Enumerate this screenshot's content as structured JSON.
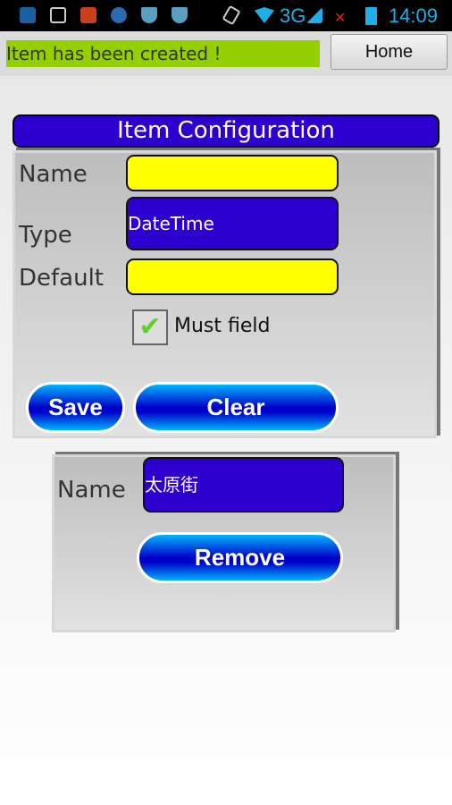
{
  "status_bar": {
    "time": "14:09",
    "network": "3G",
    "icons": [
      "sim-toolkit-icon",
      "gallery-icon",
      "s-app-icon",
      "globe-icon",
      "shield-icon",
      "shield-globe-icon",
      "rotate-icon",
      "wifi-icon",
      "signal-icon",
      "no-sim-icon",
      "battery-icon"
    ]
  },
  "top": {
    "message": "Item has been created !",
    "home_label": "Home"
  },
  "config": {
    "title": "Item Configuration",
    "name_label": "Name",
    "name_value": "",
    "type_label": "Type",
    "type_value": "DateTime",
    "default_label": "Default",
    "default_value": "",
    "must_label": "Must field",
    "must_checked": true,
    "save_label": "Save",
    "clear_label": "Clear"
  },
  "item": {
    "name_label": "Name",
    "name_value": "太原街",
    "remove_label": "Remove"
  },
  "colors": {
    "accent": "#2e00cf",
    "input": "#ffff00",
    "message_bg": "#94d000"
  }
}
